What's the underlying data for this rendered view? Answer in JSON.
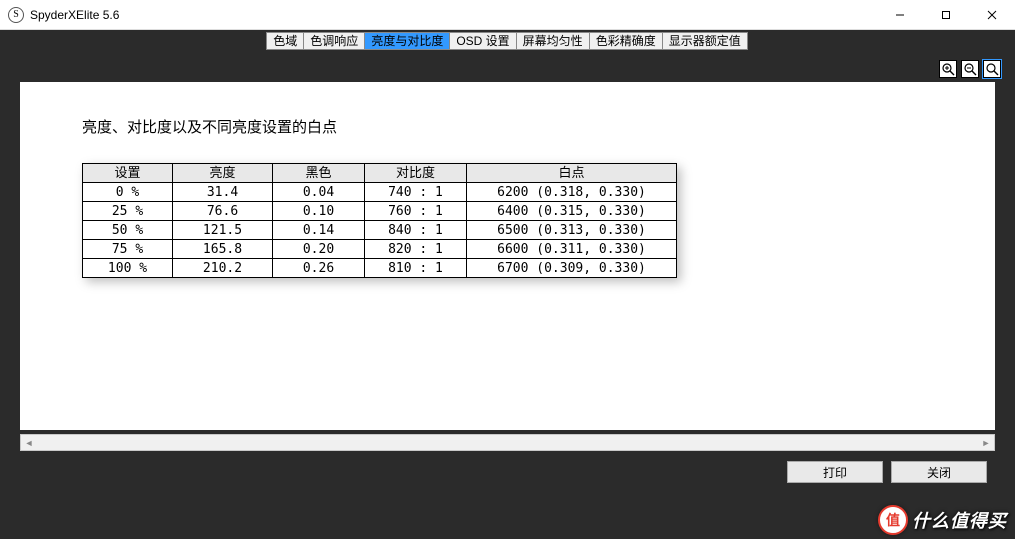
{
  "window": {
    "title": "SpyderXElite 5.6",
    "icon_glyph": "S"
  },
  "tabs": [
    {
      "label": "色域",
      "active": false
    },
    {
      "label": "色调响应",
      "active": false
    },
    {
      "label": "亮度与对比度",
      "active": true
    },
    {
      "label": "OSD 设置",
      "active": false
    },
    {
      "label": "屏幕均匀性",
      "active": false
    },
    {
      "label": "色彩精确度",
      "active": false
    },
    {
      "label": "显示器额定值",
      "active": false
    }
  ],
  "doc": {
    "heading": "亮度、对比度以及不同亮度设置的白点",
    "columns": [
      "设置",
      "亮度",
      "黑色",
      "对比度",
      "白点"
    ],
    "rows": [
      {
        "setting": "0 %",
        "brightness": "31.4",
        "black": "0.04",
        "contrast": "740 : 1",
        "white": "6200 (0.318, 0.330)"
      },
      {
        "setting": "25 %",
        "brightness": "76.6",
        "black": "0.10",
        "contrast": "760 : 1",
        "white": "6400 (0.315, 0.330)"
      },
      {
        "setting": "50 %",
        "brightness": "121.5",
        "black": "0.14",
        "contrast": "840 : 1",
        "white": "6500 (0.313, 0.330)"
      },
      {
        "setting": "75 %",
        "brightness": "165.8",
        "black": "0.20",
        "contrast": "820 : 1",
        "white": "6600 (0.311, 0.330)"
      },
      {
        "setting": "100 %",
        "brightness": "210.2",
        "black": "0.26",
        "contrast": "810 : 1",
        "white": "6700 (0.309, 0.330)"
      }
    ]
  },
  "actions": {
    "print": "打印",
    "close": "关闭"
  },
  "watermark": {
    "badge": "值",
    "text": "什么值得买"
  },
  "chart_data": {
    "type": "table",
    "title": "亮度、对比度以及不同亮度设置的白点",
    "columns": [
      "设置",
      "亮度",
      "黑色",
      "对比度",
      "白点"
    ],
    "series": [
      {
        "name": "亮度",
        "x": [
          0,
          25,
          50,
          75,
          100
        ],
        "values": [
          31.4,
          76.6,
          121.5,
          165.8,
          210.2
        ]
      },
      {
        "name": "黑色",
        "x": [
          0,
          25,
          50,
          75,
          100
        ],
        "values": [
          0.04,
          0.1,
          0.14,
          0.2,
          0.26
        ]
      },
      {
        "name": "对比度",
        "x": [
          0,
          25,
          50,
          75,
          100
        ],
        "values": [
          740,
          760,
          840,
          820,
          810
        ]
      },
      {
        "name": "白点K",
        "x": [
          0,
          25,
          50,
          75,
          100
        ],
        "values": [
          6200,
          6400,
          6500,
          6600,
          6700
        ]
      }
    ],
    "white_point_xy": [
      [
        0.318,
        0.33
      ],
      [
        0.315,
        0.33
      ],
      [
        0.313,
        0.33
      ],
      [
        0.311,
        0.33
      ],
      [
        0.309,
        0.33
      ]
    ]
  }
}
